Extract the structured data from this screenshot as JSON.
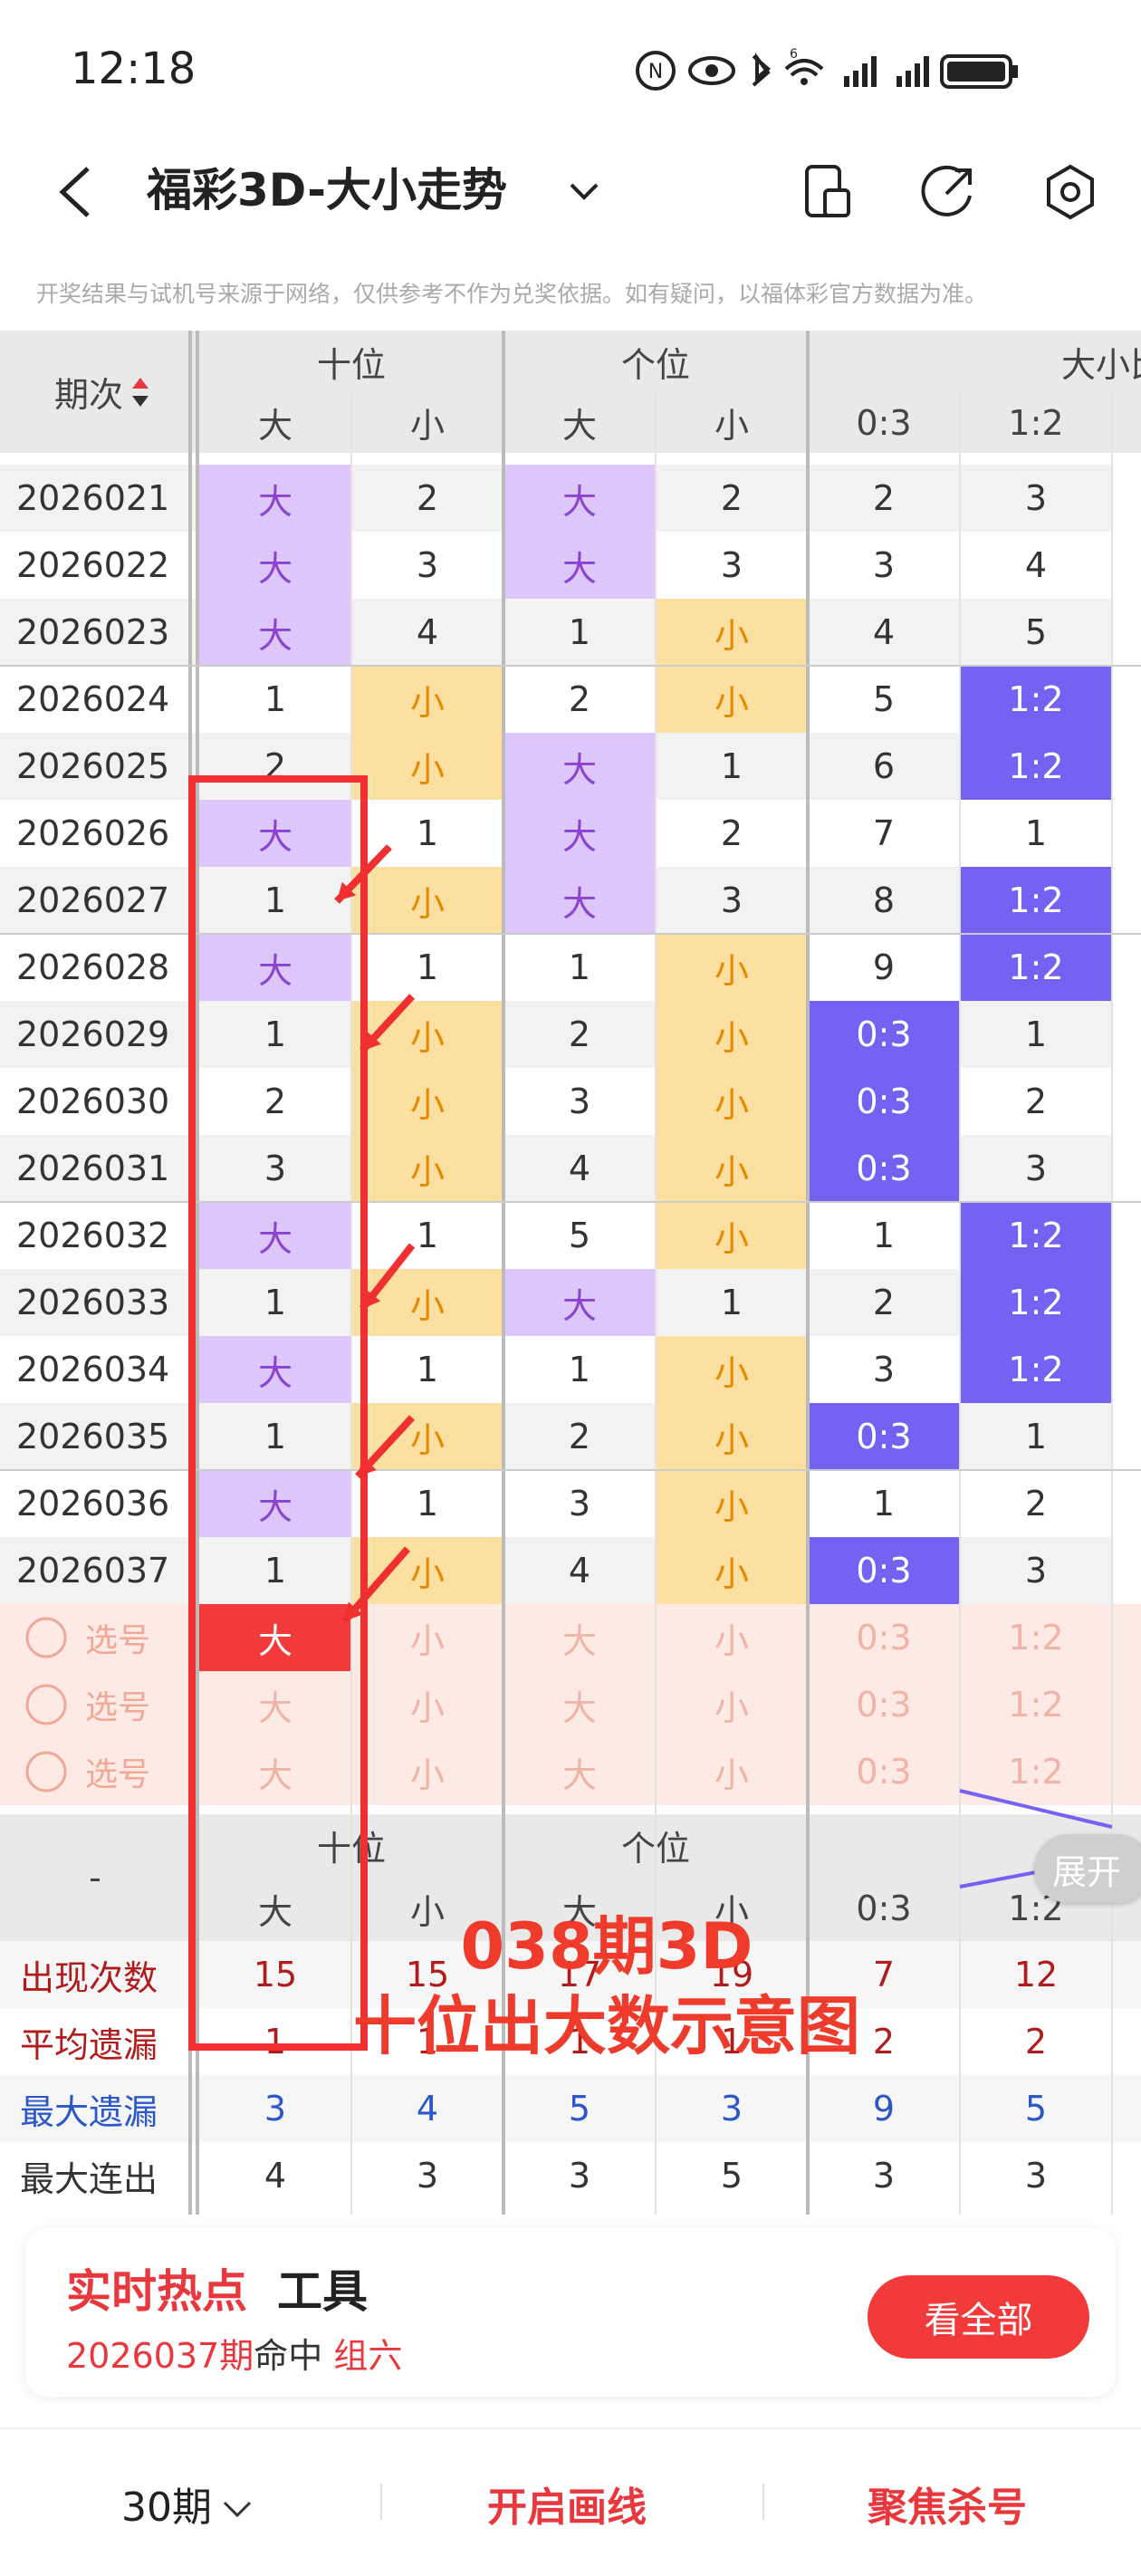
{
  "status": {
    "time": "12:18"
  },
  "header": {
    "title": "福彩3D-大小走势"
  },
  "disclaimer": "开奖结果与试机号来源于网络，仅供参考不作为兑奖依据。如有疑问，以福体彩官方数据为准。",
  "table": {
    "period_header": "期次",
    "group_headers": [
      "十位",
      "个位",
      "大小比"
    ],
    "sub_headers": [
      "大",
      "小",
      "大",
      "小",
      "0:3",
      "1:2"
    ],
    "rows": [
      {
        "p": "2026021",
        "c": [
          "大",
          "2",
          "大",
          "2",
          "2",
          "3"
        ],
        "t": [
          "b",
          "",
          "b",
          "",
          "",
          ""
        ]
      },
      {
        "p": "2026022",
        "c": [
          "大",
          "3",
          "大",
          "3",
          "3",
          "4"
        ],
        "t": [
          "b",
          "",
          "b",
          "",
          "",
          ""
        ]
      },
      {
        "p": "2026023",
        "c": [
          "大",
          "4",
          "1",
          "小",
          "4",
          "5"
        ],
        "t": [
          "b",
          "",
          "",
          "s",
          "",
          ""
        ]
      },
      {
        "p": "2026024",
        "c": [
          "1",
          "小",
          "2",
          "小",
          "5",
          "1:2"
        ],
        "t": [
          "",
          "s",
          "",
          "s",
          "",
          "x"
        ]
      },
      {
        "p": "2026025",
        "c": [
          "2",
          "小",
          "大",
          "1",
          "6",
          "1:2"
        ],
        "t": [
          "",
          "s",
          "b",
          "",
          "",
          "x"
        ]
      },
      {
        "p": "2026026",
        "c": [
          "大",
          "1",
          "大",
          "2",
          "7",
          "1"
        ],
        "t": [
          "b",
          "",
          "b",
          "",
          "",
          ""
        ]
      },
      {
        "p": "2026027",
        "c": [
          "1",
          "小",
          "大",
          "3",
          "8",
          "1:2"
        ],
        "t": [
          "",
          "s",
          "b",
          "",
          "",
          "x"
        ]
      },
      {
        "p": "2026028",
        "c": [
          "大",
          "1",
          "1",
          "小",
          "9",
          "1:2"
        ],
        "t": [
          "b",
          "",
          "",
          "s",
          "",
          "x"
        ]
      },
      {
        "p": "2026029",
        "c": [
          "1",
          "小",
          "2",
          "小",
          "0:3",
          "1"
        ],
        "t": [
          "",
          "s",
          "",
          "s",
          "x",
          ""
        ]
      },
      {
        "p": "2026030",
        "c": [
          "2",
          "小",
          "3",
          "小",
          "0:3",
          "2"
        ],
        "t": [
          "",
          "s",
          "",
          "s",
          "x",
          ""
        ]
      },
      {
        "p": "2026031",
        "c": [
          "3",
          "小",
          "4",
          "小",
          "0:3",
          "3"
        ],
        "t": [
          "",
          "s",
          "",
          "s",
          "x",
          ""
        ]
      },
      {
        "p": "2026032",
        "c": [
          "大",
          "1",
          "5",
          "小",
          "1",
          "1:2"
        ],
        "t": [
          "b",
          "",
          "",
          "s",
          "",
          "x"
        ]
      },
      {
        "p": "2026033",
        "c": [
          "1",
          "小",
          "大",
          "1",
          "2",
          "1:2"
        ],
        "t": [
          "",
          "s",
          "b",
          "",
          "",
          "x"
        ]
      },
      {
        "p": "2026034",
        "c": [
          "大",
          "1",
          "1",
          "小",
          "3",
          "1:2"
        ],
        "t": [
          "b",
          "",
          "",
          "s",
          "",
          "x"
        ]
      },
      {
        "p": "2026035",
        "c": [
          "1",
          "小",
          "2",
          "小",
          "0:3",
          "1"
        ],
        "t": [
          "",
          "s",
          "",
          "s",
          "x",
          ""
        ]
      },
      {
        "p": "2026036",
        "c": [
          "大",
          "1",
          "3",
          "小",
          "1",
          "2"
        ],
        "t": [
          "b",
          "",
          "",
          "s",
          "",
          ""
        ]
      },
      {
        "p": "2026037",
        "c": [
          "1",
          "小",
          "4",
          "小",
          "0:3",
          "3"
        ],
        "t": [
          "",
          "s",
          "",
          "s",
          "x",
          ""
        ]
      }
    ],
    "pick_label": "选号",
    "pick_cells": [
      "大",
      "小",
      "大",
      "小",
      "0:3",
      "1:2"
    ],
    "stats_first_label": "-",
    "stats": [
      {
        "label": "出现次数",
        "values": [
          "15",
          "15",
          "17",
          "19",
          "7",
          "12"
        ],
        "color": "#b01c1c"
      },
      {
        "label": "平均遗漏",
        "values": [
          "1",
          "1",
          "1",
          "1",
          "2",
          "2"
        ],
        "color": "#b01c1c"
      },
      {
        "label": "最大遗漏",
        "values": [
          "3",
          "4",
          "5",
          "3",
          "9",
          "5"
        ],
        "color": "#2b57c8"
      },
      {
        "label": "最大连出",
        "values": [
          "4",
          "3",
          "3",
          "5",
          "3",
          "3"
        ],
        "color": "#333"
      }
    ]
  },
  "overlay": {
    "line1": "038期3D",
    "line2": "十位出大数示意图"
  },
  "expand_label": "展开",
  "hot": {
    "title": "实时热点",
    "tool": "工具",
    "sub_period": "2026037期",
    "sub_mid": "命中",
    "sub_result": "组六",
    "see_all": "看全部"
  },
  "bottom": {
    "periods": "30期",
    "draw_line": "开启画线",
    "focus_kill": "聚焦杀号"
  },
  "colors": {
    "accent": "#f23a3a",
    "purple": "#dcc6fa",
    "yellow": "#fbe0a2",
    "blue": "#7561f2"
  }
}
